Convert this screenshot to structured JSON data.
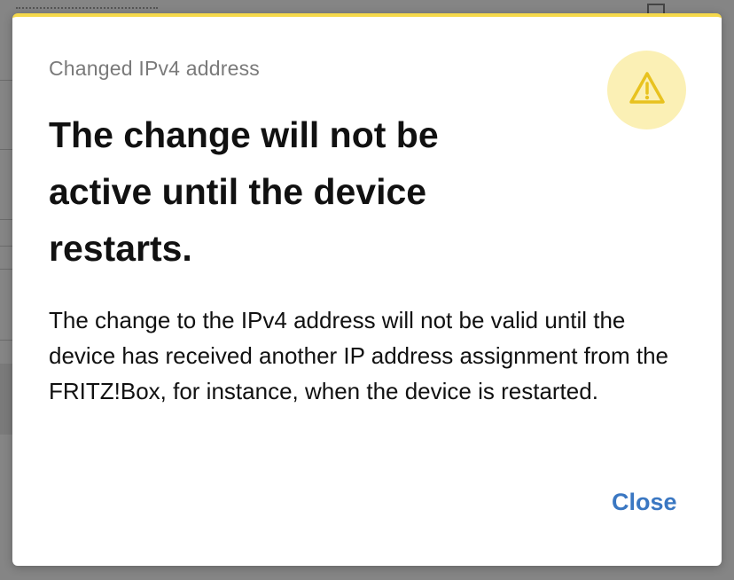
{
  "dialog": {
    "subtitle": "Changed IPv4 address",
    "headline": "The change will not be active until the device restarts.",
    "body": "The change to the IPv4 address will not be valid until the device has received another IP address assignment from the FRITZ!Box, for instance, when the device is restarted.",
    "close_label": "Close",
    "icon": "warning-icon"
  },
  "colors": {
    "accent_bar": "#f5d84a",
    "warning_badge": "#fbf0b5",
    "warning_icon": "#e8c21f",
    "link": "#3a77c2",
    "overlay": "#858585"
  }
}
